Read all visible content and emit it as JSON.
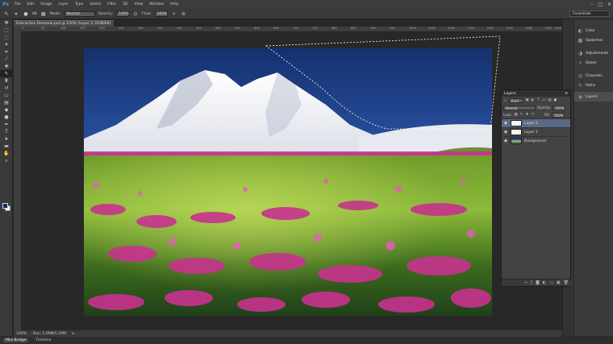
{
  "app": {
    "logo": "Ps"
  },
  "menu": [
    "File",
    "Edit",
    "Image",
    "Layer",
    "Type",
    "Select",
    "Filter",
    "3D",
    "View",
    "Window",
    "Help"
  ],
  "window_controls": [
    "–",
    "□",
    "✕"
  ],
  "options": {
    "mode_label": "Mode:",
    "mode_value": "Normal",
    "opacity_label": "Opacity:",
    "opacity_value": "100%",
    "flow_label": "Flow:",
    "flow_value": "100%",
    "brush_size": "88"
  },
  "workspace": "Essentials",
  "document": {
    "tab_title": "Distraction Removal.psd @ 100% (Layer 2, RGB/8#) *",
    "zoom": "100%",
    "doc_info": "Doc: 2.09M/5.29M"
  },
  "ruler_ticks": [
    "0",
    "50",
    "100",
    "150",
    "200",
    "250",
    "300",
    "350",
    "400",
    "450",
    "500",
    "550",
    "600",
    "650",
    "700",
    "750",
    "800",
    "850",
    "900",
    "950",
    "1000",
    "1050",
    "1100",
    "1150",
    "1200",
    "1250",
    "1300",
    "1350",
    "1400"
  ],
  "bottom_tabs": [
    "Mini Bridge",
    "Timeline"
  ],
  "panels": [
    {
      "label": "Color",
      "icon": "color-icon"
    },
    {
      "label": "Swatches",
      "icon": "swatches-icon"
    },
    {
      "label": "Adjustments",
      "icon": "adjustments-icon"
    },
    {
      "label": "Styles",
      "icon": "styles-icon"
    },
    {
      "label": "Channels",
      "icon": "channels-icon"
    },
    {
      "label": "Paths",
      "icon": "paths-icon"
    },
    {
      "label": "Layers",
      "icon": "layers-icon"
    }
  ],
  "layers_panel": {
    "title": "Layers",
    "filter_kind": "Kind",
    "blend_mode": "Normal",
    "opacity_label": "Opacity:",
    "opacity_value": "100%",
    "lock_label": "Lock:",
    "fill_label": "Fill:",
    "fill_value": "100%",
    "layers": [
      {
        "name": "Layer 2",
        "selected": true
      },
      {
        "name": "Layer 1",
        "selected": false
      },
      {
        "name": "Background",
        "selected": false
      }
    ]
  },
  "colors": {
    "accent_blue": "#31a8ff",
    "selected_layer": "#5a6a86",
    "foreground": "#0a2a6c",
    "background": "#ffffff"
  }
}
